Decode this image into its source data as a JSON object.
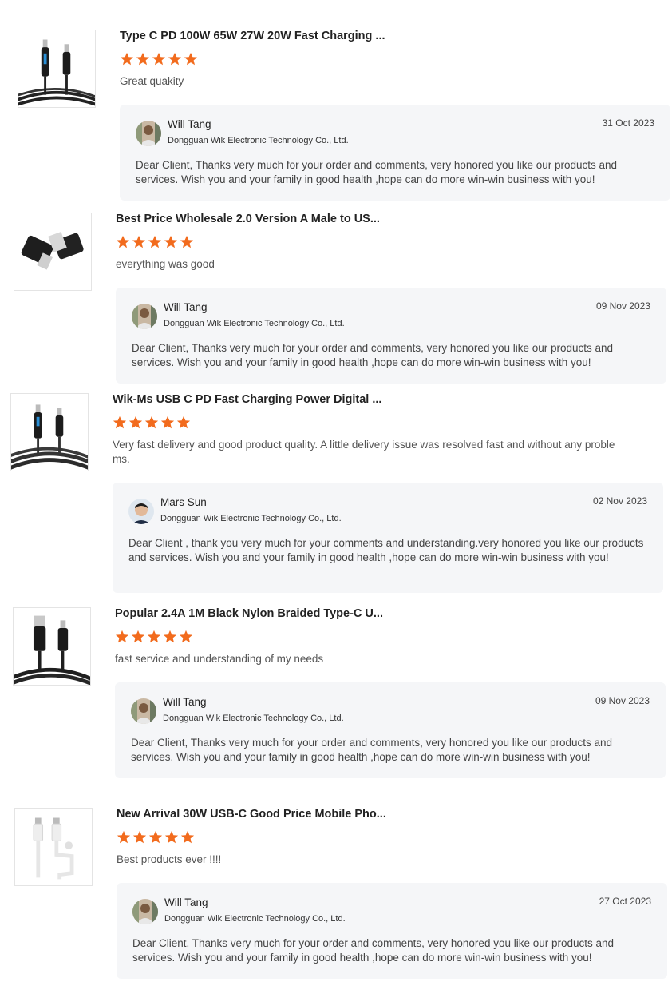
{
  "colors": {
    "star": "#f26b1d",
    "reply_bg": "#f5f6f8"
  },
  "reviews": [
    {
      "product_title": "Type C PD 100W 65W 27W 20W Fast Charging ...",
      "rating": 5,
      "comment": "Great quakity",
      "thumb_icon": "black-usb-c-cable-with-display",
      "reply": {
        "name": "Will Tang",
        "company": "Dongguan Wik Electronic Technology Co., Ltd.",
        "date": "31 Oct 2023",
        "text": "Dear Client, Thanks very much for your order and comments, very honored you like our products and services. Wish you and your family in good health ,hope can do more win-win business with you!"
      }
    },
    {
      "product_title": "Best Price Wholesale 2.0 Version A Male to US...",
      "rating": 5,
      "comment": "everything was good",
      "thumb_icon": "usb-a-adapters",
      "reply": {
        "name": "Will Tang",
        "company": "Dongguan Wik Electronic Technology Co., Ltd.",
        "date": "09 Nov 2023",
        "text": "Dear Client, Thanks very much for your order and comments, very honored you like our products and services. Wish you and your family in good health ,hope can do more win-win business with you!"
      }
    },
    {
      "product_title": "Wik-Ms USB C PD Fast Charging Power Digital ...",
      "rating": 5,
      "comment": "Very fast delivery and good product quality. A little delivery issue was resolved fast and without any proble ms.",
      "thumb_icon": "braided-usb-c-cable-with-display",
      "reply": {
        "name": "Mars Sun",
        "company": "Dongguan Wik Electronic Technology Co., Ltd.",
        "date": "02 Nov 2023",
        "text": "Dear Client , thank you very much for your comments and understanding.very honored you like our products and services. Wish you and your family in good health ,hope can do more win-win business with you!"
      }
    },
    {
      "product_title": "Popular 2.4A 1M Black Nylon Braided Type-C U...",
      "rating": 5,
      "comment": "fast service and understanding of my needs",
      "thumb_icon": "black-usb-a-to-c-cable",
      "reply": {
        "name": "Will Tang",
        "company": "Dongguan Wik Electronic Technology Co., Ltd.",
        "date": "09 Nov 2023",
        "text": "Dear Client, Thanks very much for your order and comments, very honored you like our products and services. Wish you and your family in good health ,hope can do more win-win business with you!"
      }
    },
    {
      "product_title": "New Arrival 30W USB-C Good Price Mobile Pho...",
      "rating": 5,
      "comment": "Best products ever !!!!",
      "thumb_icon": "white-usb-c-cable",
      "reply": {
        "name": "Will Tang",
        "company": "Dongguan Wik Electronic Technology Co., Ltd.",
        "date": "27 Oct 2023",
        "text": "Dear Client, Thanks very much for your order and comments, very honored you like our products and services. Wish you and your family in good health ,hope can do more win-win business with you!"
      }
    }
  ]
}
